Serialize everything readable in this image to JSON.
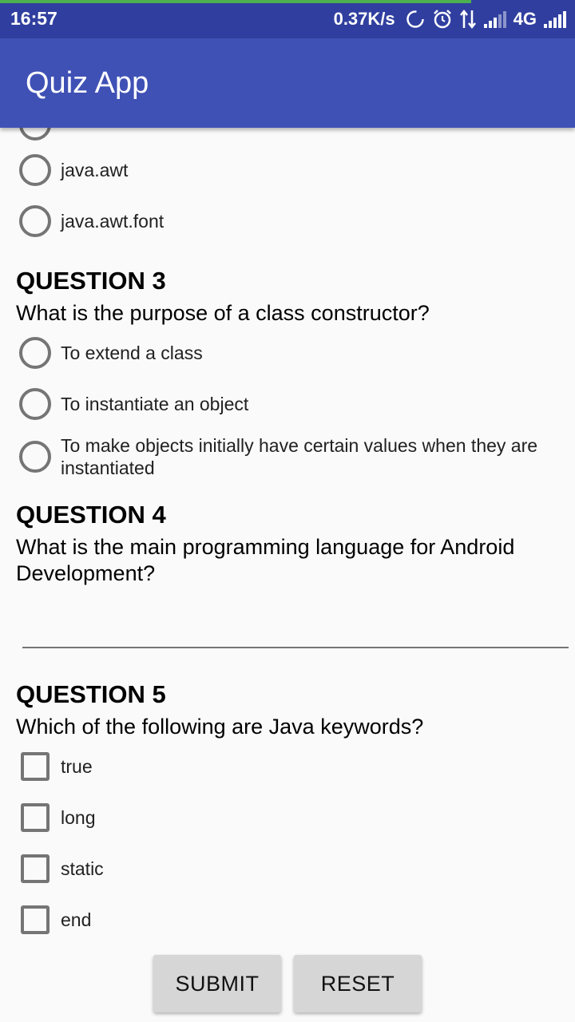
{
  "status_bar": {
    "time": "16:57",
    "net_speed": "0.37K/s",
    "network_type": "4G",
    "progress_fraction": 0.82,
    "icons": [
      "sync-icon",
      "alarm-icon",
      "data-transfer-icon",
      "signal-weak-icon",
      "signal-icon"
    ],
    "colors": {
      "background": "#303f9f",
      "progress": "#4caf50"
    }
  },
  "app_bar": {
    "title": "Quiz App",
    "color": "#3f51b5"
  },
  "question2": {
    "options": [
      {
        "label": "java.awt",
        "selected": false
      },
      {
        "label": "java.awt.font",
        "selected": false
      }
    ]
  },
  "question3": {
    "title": "QUESTION 3",
    "text": "What is the purpose of a class constructor?",
    "options": [
      {
        "label": "To extend a class",
        "selected": false
      },
      {
        "label": "To instantiate an object",
        "selected": false
      },
      {
        "label": "To make objects initially have certain values when they are instantiated",
        "selected": false
      }
    ]
  },
  "question4": {
    "title": "QUESTION 4",
    "text": "What is the main programming language for Android Development?",
    "answer_value": ""
  },
  "question5": {
    "title": "QUESTION 5",
    "text": "Which of the following are Java keywords?",
    "options": [
      {
        "label": "true",
        "checked": false
      },
      {
        "label": "long",
        "checked": false
      },
      {
        "label": "static",
        "checked": false
      },
      {
        "label": "end",
        "checked": false
      }
    ]
  },
  "buttons": {
    "submit": "SUBMIT",
    "reset": "RESET"
  }
}
